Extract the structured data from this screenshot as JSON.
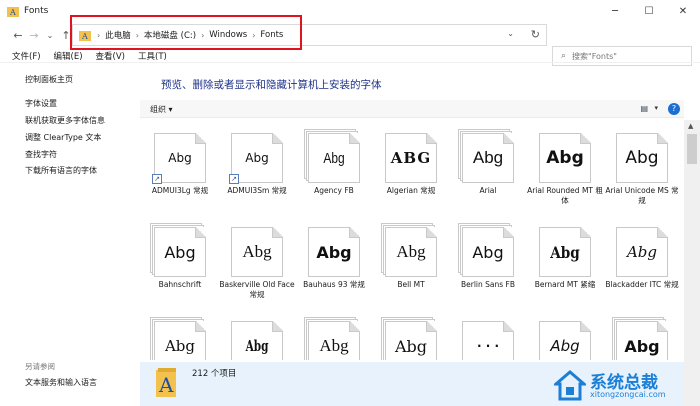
{
  "window": {
    "title": "Fonts",
    "controls": [
      "─",
      "☐",
      "✕"
    ]
  },
  "nav": {
    "back": "←",
    "forward": "→",
    "recent": "⌄",
    "up": "↑"
  },
  "address": {
    "crumbs": [
      "此电脑",
      "本地磁盘 (C:)",
      "Windows",
      "Fonts"
    ],
    "separator": "›",
    "dropdown": "⌄",
    "refresh": "↻"
  },
  "search": {
    "placeholder": "搜索\"Fonts\""
  },
  "menu": {
    "items": [
      "文件(F)",
      "编辑(E)",
      "查看(V)",
      "工具(T)"
    ]
  },
  "sidebar": {
    "title": "控制面板主页",
    "links": [
      "字体设置",
      "联机获取更多字体信息",
      "调整 ClearType 文本",
      "查找字符",
      "下载所有语言的字体"
    ],
    "see_also": "另请参阅",
    "see_also_link": "文本服务和输入语言"
  },
  "main": {
    "heading": "预览、删除或者显示和隐藏计算机上安装的字体",
    "organize": "组织 ▾",
    "view_icon": "▤",
    "view_caret": "▾",
    "help": "?"
  },
  "fonts": [
    {
      "sample": "Abg",
      "label": "ADMUI3Lg 常规",
      "shortcut": true,
      "stack": false
    },
    {
      "sample": "Abg",
      "label": "ADMUI3Sm 常规",
      "shortcut": true,
      "stack": false
    },
    {
      "sample": "Abg",
      "label": "Agency FB",
      "shortcut": false,
      "stack": true
    },
    {
      "sample": "ABG",
      "label": "Algerian 常规",
      "shortcut": false,
      "stack": false
    },
    {
      "sample": "Abg",
      "label": "Arial",
      "shortcut": false,
      "stack": true
    },
    {
      "sample": "Abg",
      "label": "Arial Rounded MT 粗体",
      "shortcut": false,
      "stack": false
    },
    {
      "sample": "Abg",
      "label": "Arial Unicode MS 常规",
      "shortcut": false,
      "stack": false
    },
    {
      "sample": "Abg",
      "label": "Bahnschrift",
      "shortcut": false,
      "stack": true
    },
    {
      "sample": "Abg",
      "label": "Baskerville Old Face 常规",
      "shortcut": false,
      "stack": false
    },
    {
      "sample": "Abg",
      "label": "Bauhaus 93 常规",
      "shortcut": false,
      "stack": false
    },
    {
      "sample": "Abg",
      "label": "Bell MT",
      "shortcut": false,
      "stack": true
    },
    {
      "sample": "Abg",
      "label": "Berlin Sans FB",
      "shortcut": false,
      "stack": true
    },
    {
      "sample": "Abg",
      "label": "Bernard MT 紧缩",
      "shortcut": false,
      "stack": false
    },
    {
      "sample": "Abg",
      "label": "Blackadder ITC 常规",
      "shortcut": false,
      "stack": false
    },
    {
      "sample": "Abg",
      "label": "",
      "shortcut": false,
      "stack": true
    },
    {
      "sample": "Abg",
      "label": "",
      "shortcut": false,
      "stack": false
    },
    {
      "sample": "Abg",
      "label": "",
      "shortcut": false,
      "stack": true
    },
    {
      "sample": "Abg",
      "label": "",
      "shortcut": false,
      "stack": true
    },
    {
      "sample": "· · ·",
      "label": "",
      "shortcut": false,
      "stack": false
    },
    {
      "sample": "Abg",
      "label": "",
      "shortcut": false,
      "stack": false
    },
    {
      "sample": "Abg",
      "label": "",
      "shortcut": false,
      "stack": true
    }
  ],
  "status": {
    "count": "212 个项目"
  },
  "watermark": {
    "text": "系统总裁",
    "url": "xitongzongcai.com"
  },
  "colors": {
    "highlight": "#e0141e",
    "heading": "#1e3287",
    "status_bg": "#e8f2fc",
    "watermark": "#1b7fd6"
  }
}
